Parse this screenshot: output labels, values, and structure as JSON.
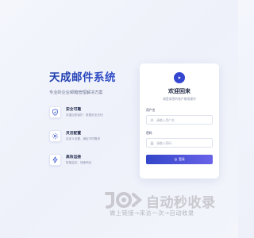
{
  "brand": {
    "title": "天成邮件系统",
    "subtitle": "专业的企业邮箱管理解决方案"
  },
  "features": [
    {
      "icon": "shield-check-icon",
      "title": "安全可靠",
      "desc": "多重加密保护，数据安全无忧"
    },
    {
      "icon": "gear-icon",
      "title": "灵活配置",
      "desc": "自定义设置，满足不同需求"
    },
    {
      "icon": "lightning-icon",
      "title": "高效运维",
      "desc": "智能监控，快速响应"
    }
  ],
  "login": {
    "title": "欢迎回来",
    "subtitle": "请登录您的账户继续操作",
    "username_label": "用户名",
    "username_placeholder": "请输入用户名",
    "password_label": "密码",
    "password_placeholder": "请输入密码",
    "submit_label": "登录"
  },
  "watermark": {
    "brand_text": "自动秒收录",
    "slogan": "做上链接→来访一次→自动收录"
  },
  "colors": {
    "accent": "#3446d0",
    "brand_gradient_end": "#6a63e8",
    "background": "#f1f4fb"
  }
}
